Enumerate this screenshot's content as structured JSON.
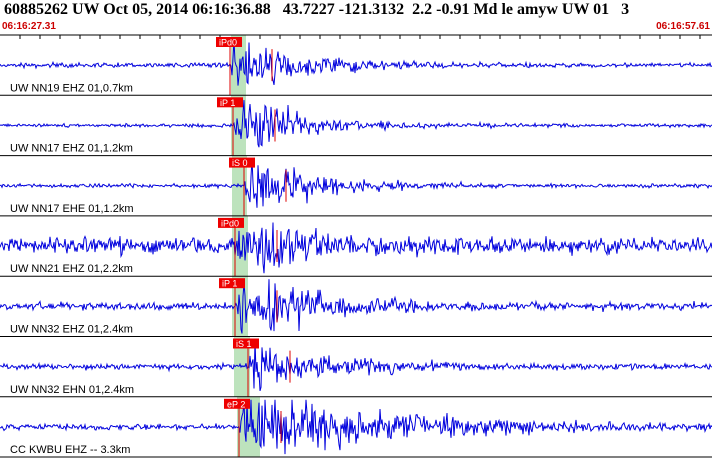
{
  "header": {
    "title": "60885262 UW Oct 05, 2014 06:16:36.88   43.7227 -121.3132  2.2 -0.91 Md le amyw UW 01   3",
    "time_start": "06:16:27.31",
    "time_end": "06:16:57.61"
  },
  "colors": {
    "trace": "#0000dd",
    "pick_box": "#ee0000",
    "pick_line": "#dd0000",
    "window_band": "#bde3bd",
    "divider": "#000000",
    "tick": "#000000"
  },
  "channels": [
    {
      "label": "UW NN19 EHZ 01,0.7km",
      "pick": "iPd0",
      "kind": "ZP"
    },
    {
      "label": "UW NN17 EHZ 01,1.2km",
      "pick": "iP 1",
      "kind": "ZP"
    },
    {
      "label": "UW NN17 EHE 01,1.2km",
      "pick": "iS 0",
      "kind": "HS"
    },
    {
      "label": "UW NN21 EHZ 01,2.2km",
      "pick": "iPd0",
      "kind": "ZP"
    },
    {
      "label": "UW NN32 EHZ 01,2.4km",
      "pick": "iP 1",
      "kind": "ZP"
    },
    {
      "label": "UW NN32 EHN 01,2.4km",
      "pick": "iS 1",
      "kind": "HS"
    },
    {
      "label": "CC KWBU EHZ -- 3.3km",
      "pick": "eP 2",
      "kind": "ZP"
    }
  ]
}
